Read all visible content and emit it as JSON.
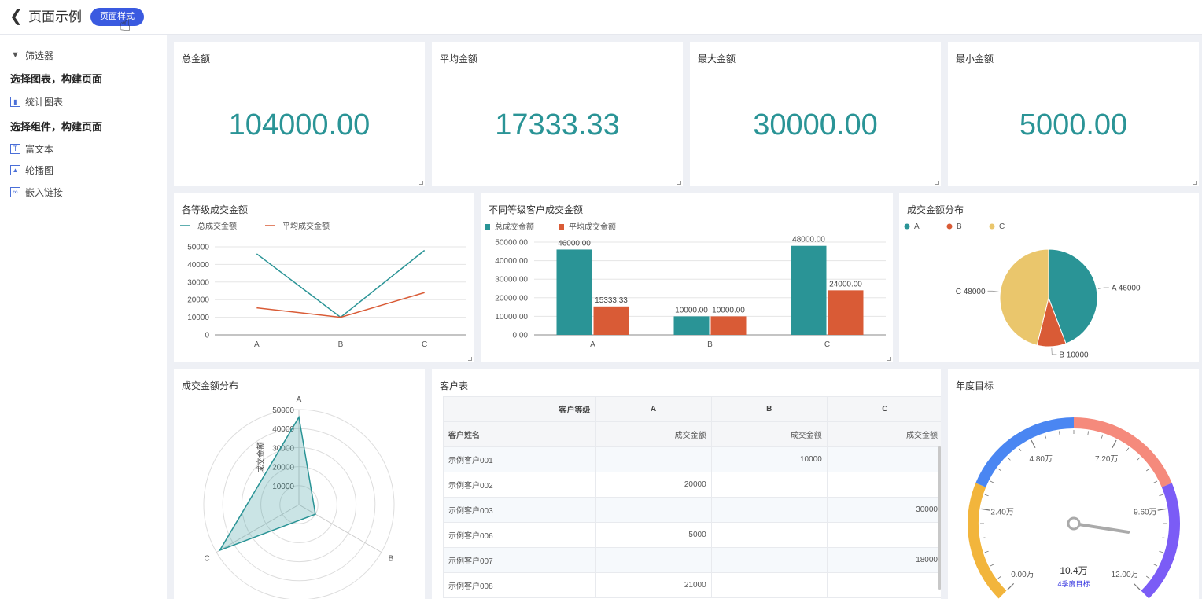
{
  "header": {
    "title": "页面示例",
    "style_button": "页面样式"
  },
  "sidebar": {
    "filter": "筛选器",
    "section_chart": "选择图表，构建页面",
    "chart_item": "统计图表",
    "section_component": "选择组件，构建页面",
    "components": [
      "富文本",
      "轮播图",
      "嵌入链接"
    ]
  },
  "kpis": [
    {
      "title": "总金额",
      "value": "104000.00"
    },
    {
      "title": "平均金额",
      "value": "17333.33"
    },
    {
      "title": "最大金额",
      "value": "30000.00"
    },
    {
      "title": "最小金额",
      "value": "5000.00"
    }
  ],
  "colors": {
    "teal": "#2a9496",
    "orange": "#d95b36",
    "yellow": "#eac66c",
    "accent": "#3a5ae0"
  },
  "line_chart": {
    "title": "各等级成交金额",
    "chart_data": {
      "type": "line",
      "categories": [
        "A",
        "B",
        "C"
      ],
      "series": [
        {
          "name": "总成交金额",
          "values": [
            46000,
            10000,
            48000
          ]
        },
        {
          "name": "平均成交金额",
          "values": [
            15333.33,
            10000,
            24000
          ]
        }
      ],
      "ylim": [
        0,
        50000
      ],
      "yticks": [
        "0",
        "10000",
        "20000",
        "30000",
        "40000",
        "50000"
      ]
    }
  },
  "bar_chart": {
    "title": "不同等级客户成交金额",
    "chart_data": {
      "type": "bar",
      "categories": [
        "A",
        "B",
        "C"
      ],
      "series": [
        {
          "name": "总成交金额",
          "values": [
            46000,
            10000,
            48000
          ],
          "labels": [
            "46000.00",
            "10000.00",
            "48000.00"
          ]
        },
        {
          "name": "平均成交金额",
          "values": [
            15333.33,
            10000,
            24000
          ],
          "labels": [
            "15333.33",
            "10000.00",
            "24000.00"
          ]
        }
      ],
      "ylim": [
        0,
        50000
      ],
      "yticks": [
        "0.00",
        "10000.00",
        "20000.00",
        "30000.00",
        "40000.00",
        "50000.00"
      ]
    }
  },
  "pie_chart": {
    "title": "成交金额分布",
    "chart_data": {
      "type": "pie",
      "labels": [
        "A",
        "B",
        "C"
      ],
      "values": [
        46000,
        10000,
        48000
      ],
      "slice_labels": [
        "A 46000",
        "B 10000",
        "C 48000"
      ]
    }
  },
  "radar_chart": {
    "title": "成交金额分布",
    "chart_data": {
      "type": "radar",
      "indicators": [
        "A",
        "B",
        "C"
      ],
      "values": [
        46000,
        10000,
        48000
      ],
      "max": 50000,
      "axis_name": "成交金额",
      "rings": [
        "10000",
        "20000",
        "30000",
        "40000",
        "50000"
      ]
    }
  },
  "table": {
    "title": "客户表",
    "header_top": [
      "客户等级",
      "A",
      "B",
      "C"
    ],
    "header_sub": [
      "客户姓名",
      "成交金额",
      "成交金额",
      "成交金额"
    ],
    "rows": [
      [
        "示例客户001",
        "",
        "10000",
        ""
      ],
      [
        "示例客户002",
        "20000",
        "",
        ""
      ],
      [
        "示例客户003",
        "",
        "",
        "30000"
      ],
      [
        "示例客户006",
        "5000",
        "",
        ""
      ],
      [
        "示例客户007",
        "",
        "",
        "18000"
      ],
      [
        "示例客户008",
        "21000",
        "",
        ""
      ]
    ]
  },
  "gauge": {
    "title": "年度目标",
    "value_text": "10.4万",
    "target_label": "4季度目标",
    "value": 10.4,
    "max": 12,
    "ticks": [
      "0.00万",
      "2.40万",
      "4.80万",
      "7.20万",
      "9.60万",
      "12.00万"
    ],
    "segment_colors": [
      "#f2b53c",
      "#4a86f2",
      "#f58a7c",
      "#7b5cf6"
    ]
  }
}
